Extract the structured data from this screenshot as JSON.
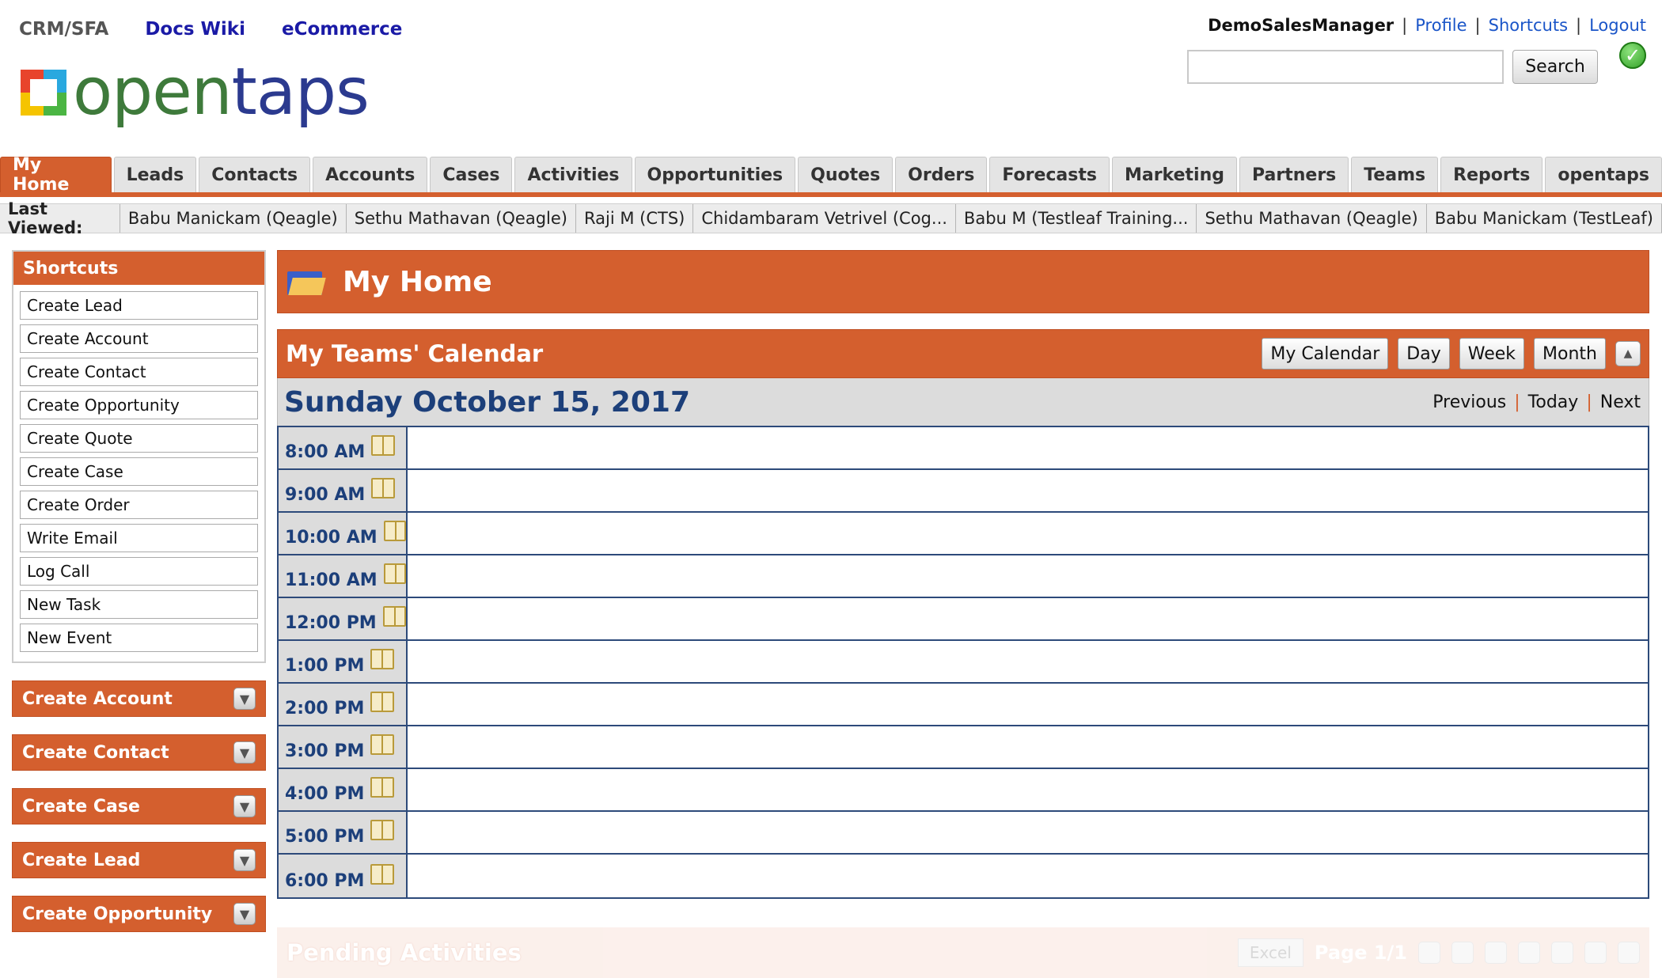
{
  "apps": {
    "current": "CRM/SFA",
    "links": [
      "Docs Wiki",
      "eCommerce"
    ]
  },
  "logo": {
    "text_part1": "open",
    "text_part2": "taps"
  },
  "user_bar": {
    "username": "DemoSalesManager",
    "links": [
      "Profile",
      "Shortcuts",
      "Logout"
    ],
    "separator": "|"
  },
  "search": {
    "value": "",
    "button_label": "Search"
  },
  "tabs": [
    "My Home",
    "Leads",
    "Contacts",
    "Accounts",
    "Cases",
    "Activities",
    "Opportunities",
    "Quotes",
    "Orders",
    "Forecasts",
    "Marketing",
    "Partners",
    "Teams",
    "Reports",
    "opentaps"
  ],
  "active_tab": "My Home",
  "last_viewed": {
    "label": "Last Viewed:",
    "items": [
      "Babu Manickam (Qeagle)",
      "Sethu Mathavan (Qeagle)",
      "Raji M (CTS)",
      "Chidambaram Vetrivel (Cog...",
      "Babu M (Testleaf Training...",
      "Sethu Mathavan (Qeagle)",
      "Babu Manickam (TestLeaf)"
    ]
  },
  "sidebar": {
    "shortcuts_title": "Shortcuts",
    "shortcuts": [
      "Create Lead",
      "Create Account",
      "Create Contact",
      "Create Opportunity",
      "Create Quote",
      "Create Case",
      "Create Order",
      "Write Email",
      "Log Call",
      "New Task",
      "New Event"
    ],
    "collapsed_panels": [
      "Create Account",
      "Create Contact",
      "Create Case",
      "Create Lead",
      "Create Opportunity"
    ]
  },
  "page": {
    "title": "My Home"
  },
  "calendar": {
    "title": "My Teams' Calendar",
    "view_buttons": [
      "My Calendar",
      "Day",
      "Week",
      "Month"
    ],
    "date": "Sunday October 15, 2017",
    "nav": [
      "Previous",
      "Today",
      "Next"
    ],
    "nav_separator": "|",
    "slots": [
      "8:00 AM",
      "9:00 AM",
      "10:00 AM",
      "11:00 AM",
      "12:00 PM",
      "1:00 PM",
      "2:00 PM",
      "3:00 PM",
      "4:00 PM",
      "5:00 PM",
      "6:00 PM"
    ]
  },
  "pending": {
    "title": "Pending Activities",
    "export_label": "Excel",
    "page_label": "Page 1/1"
  },
  "colors": {
    "brand_orange": "#d45f2e",
    "link_blue": "#1a55c8",
    "date_blue": "#1c3f7a"
  }
}
